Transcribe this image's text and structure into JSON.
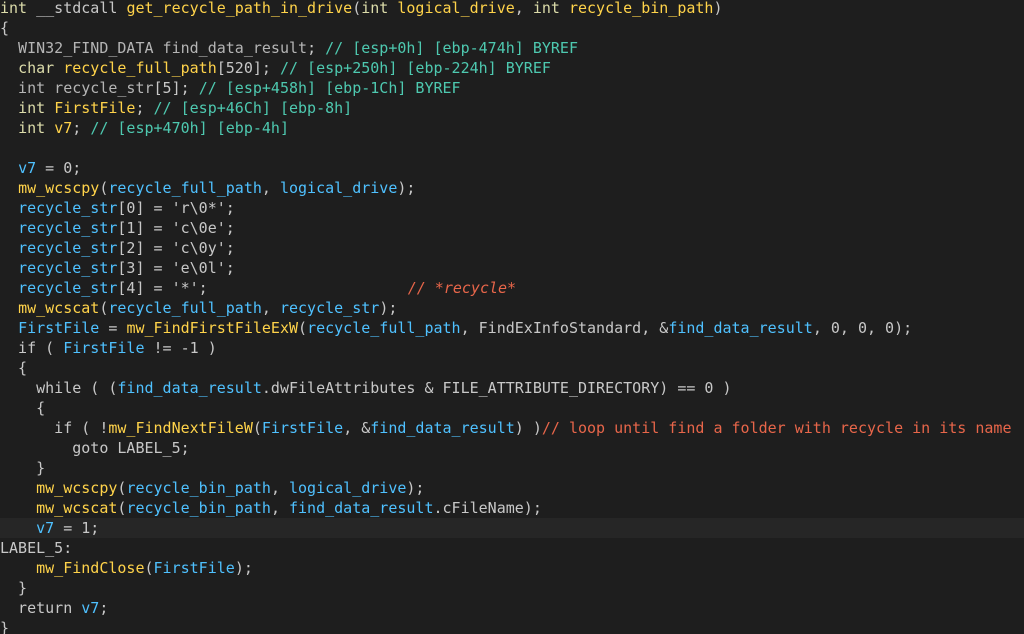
{
  "colors": {
    "background": "#1e1e1e",
    "current_line": "#262626",
    "text": "#c8c8c8",
    "keyword": "#dcdcaa",
    "function": "#ffd34a",
    "variable": "#4fc1ff",
    "global": "#5ee3e3",
    "comment": "#4ec9b0",
    "comment_red": "#e8664a",
    "type_gray": "#b5b5b5"
  },
  "editor": {
    "highlighted_line": 26,
    "lines": [
      {
        "tokens": [
          {
            "t": "int",
            "c": "keyword"
          },
          {
            "t": " __stdcall ",
            "c": "text"
          },
          {
            "t": "get_recycle_path_in_drive",
            "c": "function"
          },
          {
            "t": "(",
            "c": "text"
          },
          {
            "t": "int",
            "c": "keyword"
          },
          {
            "t": " ",
            "c": "text"
          },
          {
            "t": "logical_drive",
            "c": "function"
          },
          {
            "t": ", ",
            "c": "text"
          },
          {
            "t": "int",
            "c": "keyword"
          },
          {
            "t": " ",
            "c": "text"
          },
          {
            "t": "recycle_bin_path",
            "c": "function"
          },
          {
            "t": ")",
            "c": "text"
          }
        ]
      },
      {
        "tokens": [
          {
            "t": "{",
            "c": "text"
          }
        ]
      },
      {
        "tokens": [
          {
            "t": "  WIN32_FIND_DATA",
            "c": "type_gray"
          },
          {
            "t": " find_data_result",
            "c": "type_gray"
          },
          {
            "t": "; ",
            "c": "text"
          },
          {
            "t": "// [esp+0h] [ebp-474h] BYREF",
            "c": "comment"
          }
        ]
      },
      {
        "tokens": [
          {
            "t": "  ",
            "c": "text"
          },
          {
            "t": "char",
            "c": "keyword"
          },
          {
            "t": " ",
            "c": "text"
          },
          {
            "t": "recycle_full_path",
            "c": "function"
          },
          {
            "t": "[520]",
            "c": "text"
          },
          {
            "t": "; ",
            "c": "text"
          },
          {
            "t": "// [esp+250h] [ebp-224h] BYREF",
            "c": "comment"
          }
        ]
      },
      {
        "tokens": [
          {
            "t": "  int",
            "c": "type_gray"
          },
          {
            "t": " recycle_str",
            "c": "type_gray"
          },
          {
            "t": "[5]",
            "c": "text"
          },
          {
            "t": "; ",
            "c": "text"
          },
          {
            "t": "// [esp+458h] [ebp-1Ch] BYREF",
            "c": "comment"
          }
        ]
      },
      {
        "tokens": [
          {
            "t": "  ",
            "c": "text"
          },
          {
            "t": "int",
            "c": "keyword"
          },
          {
            "t": " ",
            "c": "text"
          },
          {
            "t": "FirstFile",
            "c": "function"
          },
          {
            "t": "; ",
            "c": "text"
          },
          {
            "t": "// [esp+46Ch] [ebp-8h]",
            "c": "comment"
          }
        ]
      },
      {
        "tokens": [
          {
            "t": "  ",
            "c": "text"
          },
          {
            "t": "int",
            "c": "keyword"
          },
          {
            "t": " ",
            "c": "text"
          },
          {
            "t": "v7",
            "c": "function"
          },
          {
            "t": "; ",
            "c": "text"
          },
          {
            "t": "// [esp+470h] [ebp-4h]",
            "c": "comment"
          }
        ]
      },
      {
        "tokens": []
      },
      {
        "tokens": [
          {
            "t": "  ",
            "c": "text"
          },
          {
            "t": "v7",
            "c": "variable"
          },
          {
            "t": " = 0;",
            "c": "text"
          }
        ]
      },
      {
        "tokens": [
          {
            "t": "  ",
            "c": "text"
          },
          {
            "t": "mw_wcscpy",
            "c": "function"
          },
          {
            "t": "(",
            "c": "text"
          },
          {
            "t": "recycle_full_path",
            "c": "variable"
          },
          {
            "t": ", ",
            "c": "text"
          },
          {
            "t": "logical_drive",
            "c": "variable"
          },
          {
            "t": ");",
            "c": "text"
          }
        ]
      },
      {
        "tokens": [
          {
            "t": "  ",
            "c": "text"
          },
          {
            "t": "recycle_str",
            "c": "variable"
          },
          {
            "t": "[0] = 'r\\0*';",
            "c": "text"
          }
        ]
      },
      {
        "tokens": [
          {
            "t": "  ",
            "c": "text"
          },
          {
            "t": "recycle_str",
            "c": "variable"
          },
          {
            "t": "[1] = 'c\\0e';",
            "c": "text"
          }
        ]
      },
      {
        "tokens": [
          {
            "t": "  ",
            "c": "text"
          },
          {
            "t": "recycle_str",
            "c": "variable"
          },
          {
            "t": "[2] = 'c\\0y';",
            "c": "text"
          }
        ]
      },
      {
        "tokens": [
          {
            "t": "  ",
            "c": "text"
          },
          {
            "t": "recycle_str",
            "c": "variable"
          },
          {
            "t": "[3] = 'e\\0l';",
            "c": "text"
          }
        ]
      },
      {
        "tokens": [
          {
            "t": "  ",
            "c": "text"
          },
          {
            "t": "recycle_str",
            "c": "variable"
          },
          {
            "t": "[4] = '*';",
            "c": "text"
          },
          {
            "t": "",
            "c": "gap",
            "gap": 200
          },
          {
            "t": "// *recycle*",
            "c": "comment_red",
            "italic": true
          }
        ]
      },
      {
        "tokens": [
          {
            "t": "  ",
            "c": "text"
          },
          {
            "t": "mw_wcscat",
            "c": "function"
          },
          {
            "t": "(",
            "c": "text"
          },
          {
            "t": "recycle_full_path",
            "c": "variable"
          },
          {
            "t": ", ",
            "c": "text"
          },
          {
            "t": "recycle_str",
            "c": "variable"
          },
          {
            "t": ");",
            "c": "text"
          }
        ]
      },
      {
        "tokens": [
          {
            "t": "  ",
            "c": "text"
          },
          {
            "t": "FirstFile",
            "c": "variable"
          },
          {
            "t": " = ",
            "c": "text"
          },
          {
            "t": "mw_FindFirstFileExW",
            "c": "function"
          },
          {
            "t": "(",
            "c": "text"
          },
          {
            "t": "recycle_full_path",
            "c": "variable"
          },
          {
            "t": ", ",
            "c": "text"
          },
          {
            "t": "FindExInfoStandard",
            "c": "text"
          },
          {
            "t": ", &",
            "c": "text"
          },
          {
            "t": "find_data_result",
            "c": "variable"
          },
          {
            "t": ", 0, 0, 0);",
            "c": "text"
          }
        ]
      },
      {
        "tokens": [
          {
            "t": "  if ( ",
            "c": "text"
          },
          {
            "t": "FirstFile",
            "c": "variable"
          },
          {
            "t": " != -1 )",
            "c": "text"
          }
        ]
      },
      {
        "tokens": [
          {
            "t": "  {",
            "c": "text"
          }
        ]
      },
      {
        "tokens": [
          {
            "t": "    while ( (",
            "c": "text"
          },
          {
            "t": "find_data_result",
            "c": "variable"
          },
          {
            "t": ".dwFileAttributes & ",
            "c": "text"
          },
          {
            "t": "FILE_ATTRIBUTE_DIRECTORY",
            "c": "text"
          },
          {
            "t": ") == 0 )",
            "c": "text"
          }
        ]
      },
      {
        "tokens": [
          {
            "t": "    {",
            "c": "text"
          }
        ]
      },
      {
        "tokens": [
          {
            "t": "      if ( !",
            "c": "text"
          },
          {
            "t": "mw_FindNextFileW",
            "c": "function"
          },
          {
            "t": "(",
            "c": "text"
          },
          {
            "t": "FirstFile",
            "c": "variable"
          },
          {
            "t": ", &",
            "c": "text"
          },
          {
            "t": "find_data_result",
            "c": "variable"
          },
          {
            "t": ") )",
            "c": "text"
          },
          {
            "t": "// loop until find a folder with recycle in its name",
            "c": "comment_red"
          }
        ]
      },
      {
        "tokens": [
          {
            "t": "        goto LABEL_5;",
            "c": "text"
          }
        ]
      },
      {
        "tokens": [
          {
            "t": "    }",
            "c": "text"
          }
        ]
      },
      {
        "tokens": [
          {
            "t": "    ",
            "c": "text"
          },
          {
            "t": "mw_wcscpy",
            "c": "function"
          },
          {
            "t": "(",
            "c": "text"
          },
          {
            "t": "recycle_bin_path",
            "c": "variable"
          },
          {
            "t": ", ",
            "c": "text"
          },
          {
            "t": "logical_drive",
            "c": "variable"
          },
          {
            "t": ");",
            "c": "text"
          }
        ]
      },
      {
        "tokens": [
          {
            "t": "    ",
            "c": "text"
          },
          {
            "t": "mw_wcscat",
            "c": "function"
          },
          {
            "t": "(",
            "c": "text"
          },
          {
            "t": "recycle_bin_path",
            "c": "variable"
          },
          {
            "t": ", ",
            "c": "text"
          },
          {
            "t": "find_data_result",
            "c": "variable"
          },
          {
            "t": ".cFileName);",
            "c": "text"
          }
        ]
      },
      {
        "tokens": [
          {
            "t": "    ",
            "c": "text"
          },
          {
            "t": "v7",
            "c": "variable"
          },
          {
            "t": " = 1;",
            "c": "text"
          }
        ]
      },
      {
        "tokens": [
          {
            "t": "LABEL_5:",
            "c": "text"
          }
        ]
      },
      {
        "tokens": [
          {
            "t": "    ",
            "c": "text"
          },
          {
            "t": "mw_FindClose",
            "c": "function"
          },
          {
            "t": "(",
            "c": "text"
          },
          {
            "t": "FirstFile",
            "c": "variable"
          },
          {
            "t": ");",
            "c": "text"
          }
        ]
      },
      {
        "tokens": [
          {
            "t": "  }",
            "c": "text"
          }
        ]
      },
      {
        "tokens": [
          {
            "t": "  return ",
            "c": "text"
          },
          {
            "t": "v7",
            "c": "variable"
          },
          {
            "t": ";",
            "c": "text"
          }
        ]
      },
      {
        "tokens": [
          {
            "t": "}",
            "c": "text"
          }
        ]
      }
    ]
  }
}
